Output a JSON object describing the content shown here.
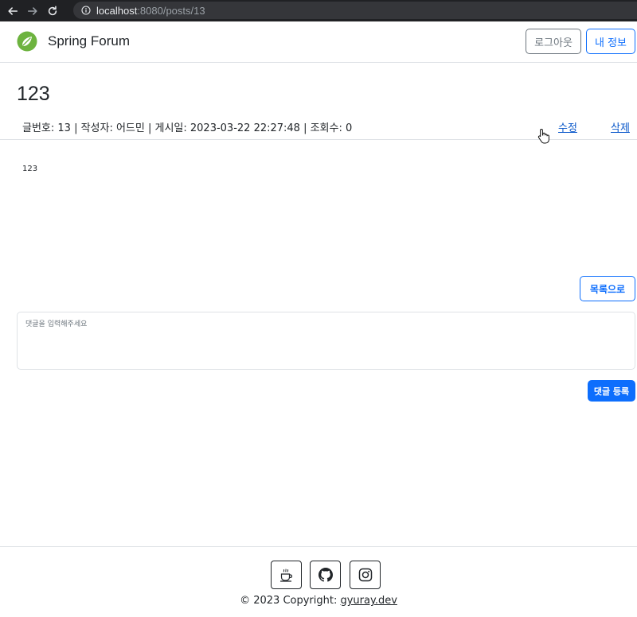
{
  "browser": {
    "url_host": "localhost",
    "url_rest": ":8080/posts/13"
  },
  "navbar": {
    "brand": "Spring Forum",
    "logout_label": "로그아웃",
    "myinfo_label": "내 정보"
  },
  "post": {
    "title": "123",
    "meta": "글번호: 13 | 작성자: 어드민 | 게시일: 2023-03-22 22:27:48 | 조회수: 0",
    "edit_label": "수정",
    "delete_label": "삭제",
    "content": "123"
  },
  "actions": {
    "list_label": "목록으로"
  },
  "comment": {
    "placeholder": "댓글을 입력해주세요",
    "submit_label": "댓글 등록"
  },
  "footer": {
    "copyright_prefix": "© 2023 Copyright: ",
    "copyright_link": "gyuray.dev",
    "icons": [
      "coffee-icon",
      "github-icon",
      "instagram-icon"
    ]
  },
  "colors": {
    "primary": "#0d6efd",
    "secondary": "#6c757d",
    "brand_green": "#6db33f"
  }
}
